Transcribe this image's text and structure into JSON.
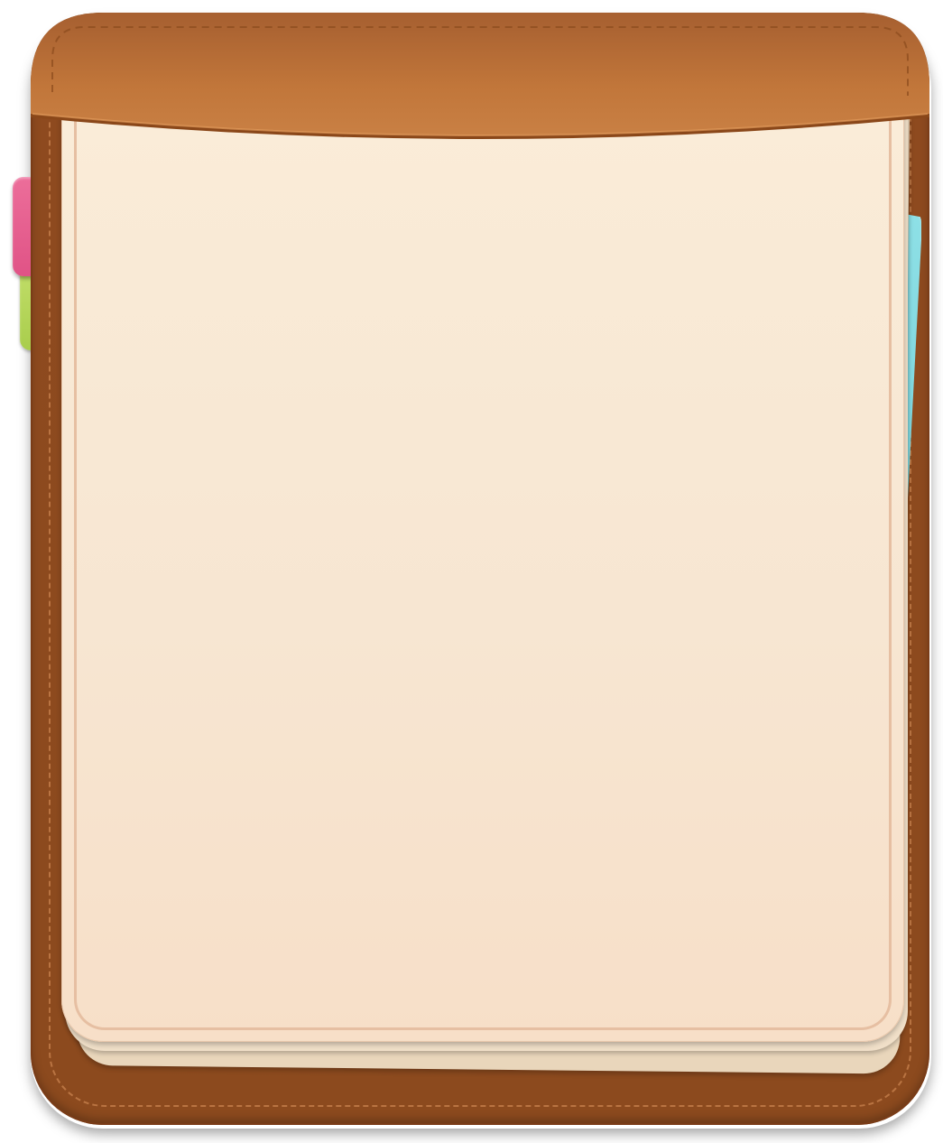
{
  "folio": {
    "leather_color": "#8c4a1e",
    "flap_color": "#c47a3c",
    "stitch_color": "#c9824e"
  },
  "page": {
    "paper_color": "#f9ead6",
    "border_color": "#e6bfa2"
  },
  "tabs": [
    {
      "name": "pink-tab",
      "color": "#e05386"
    },
    {
      "name": "green-tab",
      "color": "#a9cd4c"
    },
    {
      "name": "blue-tab",
      "color": "#7ad4dc"
    }
  ]
}
